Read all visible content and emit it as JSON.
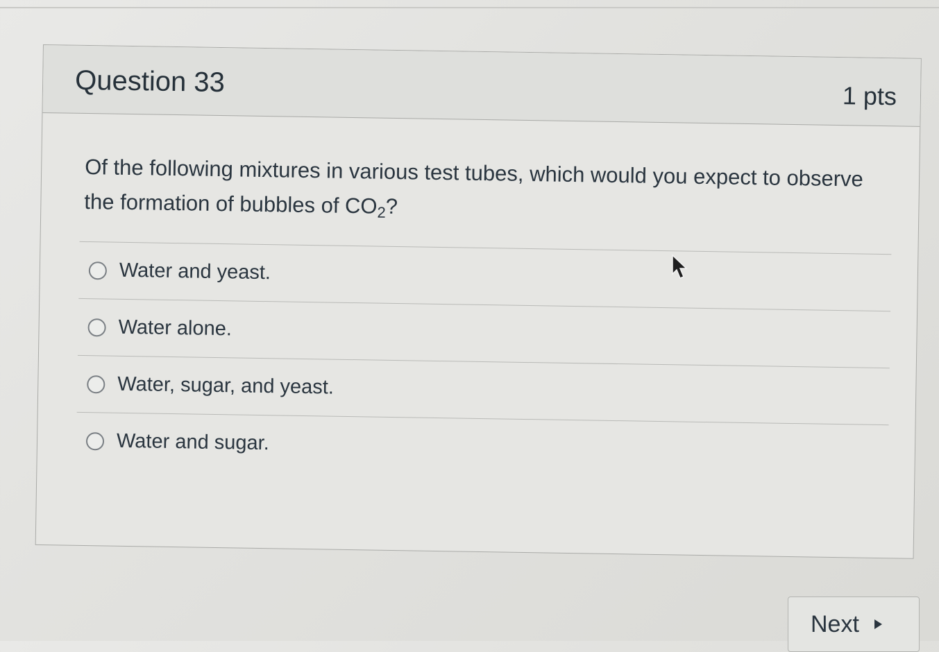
{
  "question": {
    "title": "Question 33",
    "points": "1 pts",
    "text_before": "Of the following mixtures in various test tubes, which would you expect to observe the formation of  bubbles of CO",
    "subscript": "2",
    "text_after": "?"
  },
  "answers": [
    {
      "label": "Water and yeast."
    },
    {
      "label": "Water alone."
    },
    {
      "label": "Water, sugar, and yeast."
    },
    {
      "label": "Water and sugar."
    }
  ],
  "navigation": {
    "next_label": "Next",
    "next_icon": "triangle-right-icon"
  },
  "pointer": {
    "icon": "mouse-cursor-icon"
  }
}
